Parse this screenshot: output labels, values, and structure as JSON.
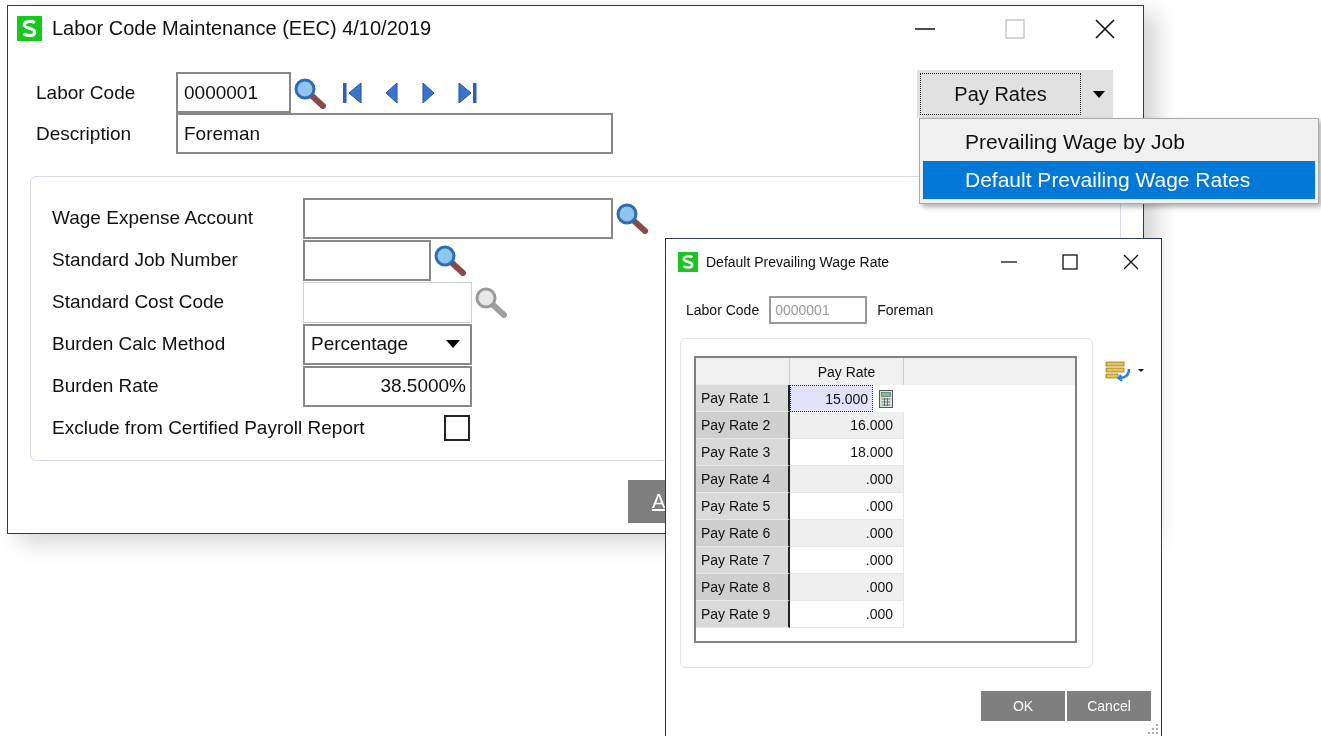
{
  "main_window": {
    "title": "Labor Code Maintenance (EEC) 4/10/2019",
    "maximize_disabled": true,
    "labor_code": {
      "label": "Labor Code",
      "value": "0000001"
    },
    "description": {
      "label": "Description",
      "value": "Foreman"
    },
    "pay_rates_button": {
      "label": "Pay Rates"
    },
    "pay_rates_menu": [
      {
        "label": "Prevailing Wage by Job",
        "selected": false
      },
      {
        "label": "Default Prevailing Wage Rates",
        "selected": true
      }
    ],
    "fields": [
      {
        "kind": "lookup",
        "label": "Wage Expense Account",
        "disabled": false
      },
      {
        "kind": "lookup",
        "label": "Standard Job Number",
        "disabled": false
      },
      {
        "kind": "lookup",
        "label": "Standard Cost Code",
        "disabled": true
      },
      {
        "kind": "dropdown",
        "label": "Burden Calc Method",
        "value": "Percentage"
      },
      {
        "kind": "number",
        "label": "Burden Rate",
        "value": "38.5000%"
      },
      {
        "kind": "checkbox",
        "label": "Exclude from Certified Payroll Report",
        "checked": false
      }
    ],
    "cut_button": {
      "label": "A"
    }
  },
  "dialog": {
    "title": "Default Prevailing Wage Rate",
    "labor_code": {
      "label": "Labor Code",
      "value": "0000001",
      "disabled": true,
      "description": "Foreman"
    },
    "grid": {
      "columns": [
        "Pay Rate"
      ],
      "rows": [
        {
          "label": "Pay Rate 1",
          "value": "15.000",
          "selected": true
        },
        {
          "label": "Pay Rate 2",
          "value": "16.000",
          "selected": false
        },
        {
          "label": "Pay Rate 3",
          "value": "18.000",
          "selected": false
        },
        {
          "label": "Pay Rate 4",
          "value": ".000",
          "selected": false
        },
        {
          "label": "Pay Rate 5",
          "value": ".000",
          "selected": false
        },
        {
          "label": "Pay Rate 6",
          "value": ".000",
          "selected": false
        },
        {
          "label": "Pay Rate 7",
          "value": ".000",
          "selected": false
        },
        {
          "label": "Pay Rate 8",
          "value": ".000",
          "selected": false
        },
        {
          "label": "Pay Rate 9",
          "value": ".000",
          "selected": false
        }
      ]
    },
    "buttons": [
      {
        "label": "OK"
      },
      {
        "label": "Cancel"
      }
    ]
  }
}
